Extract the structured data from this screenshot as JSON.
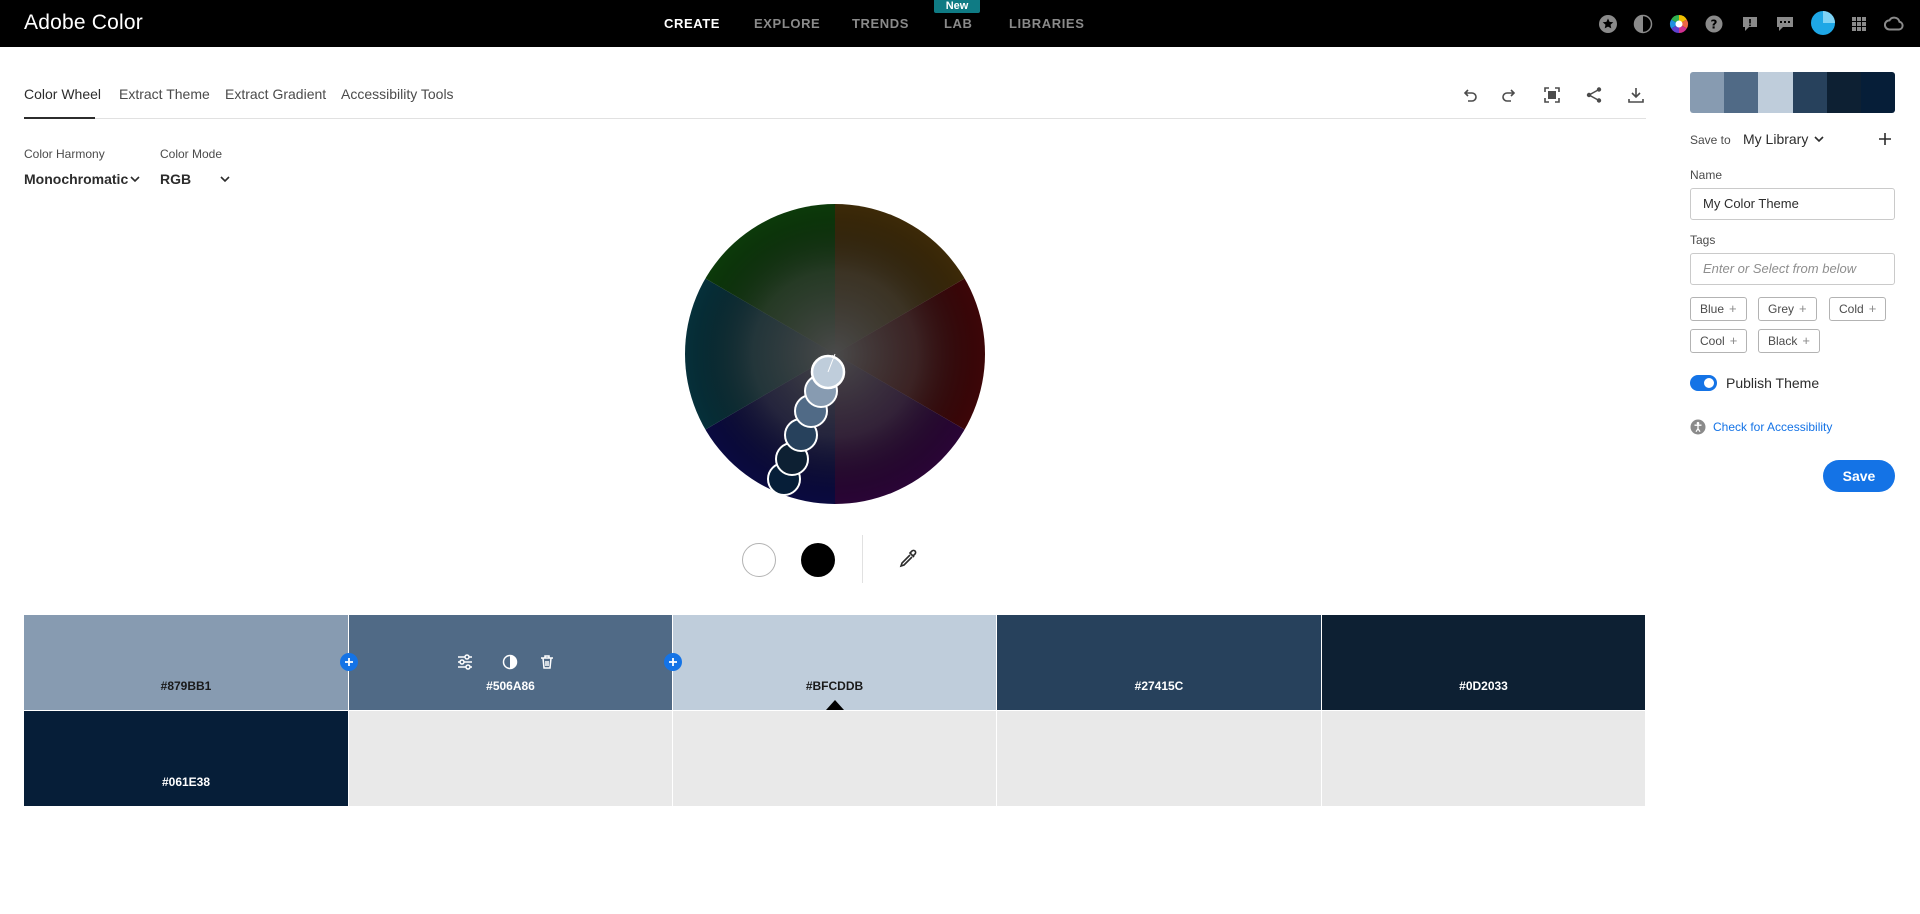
{
  "app": {
    "title": "Adobe Color"
  },
  "nav": {
    "items": [
      {
        "label": "CREATE",
        "active": true
      },
      {
        "label": "EXPLORE",
        "active": false
      },
      {
        "label": "TRENDS",
        "active": false
      },
      {
        "label": "LAB",
        "active": false,
        "badge": "New"
      },
      {
        "label": "LIBRARIES",
        "active": false
      }
    ],
    "icons": [
      "star-icon",
      "contrast-icon",
      "color-wheel-icon",
      "help-icon",
      "feedback-icon",
      "chat-icon",
      "avatar",
      "apps-grid-icon",
      "creative-cloud-icon"
    ]
  },
  "tabs": [
    {
      "label": "Color Wheel",
      "active": true
    },
    {
      "label": "Extract Theme",
      "active": false
    },
    {
      "label": "Extract Gradient",
      "active": false
    },
    {
      "label": "Accessibility Tools",
      "active": false
    }
  ],
  "toolbar": [
    "undo-icon",
    "redo-icon",
    "fullscreen-icon",
    "share-icon",
    "download-icon"
  ],
  "controls": {
    "harmony_label": "Color Harmony",
    "harmony_value": "Monochromatic",
    "mode_label": "Color Mode",
    "mode_value": "RGB"
  },
  "swatches": [
    {
      "hex": "#879BB1",
      "color": "#879bb1",
      "text_color": "#1a1a1a"
    },
    {
      "hex": "#506A86",
      "color": "#506a86",
      "text_color": "#ffffff",
      "selected": true
    },
    {
      "hex": "#BFCDDB",
      "color": "#bfcddb",
      "text_color": "#1a1a1a",
      "base": true
    },
    {
      "hex": "#27415C",
      "color": "#27415c",
      "text_color": "#ffffff"
    },
    {
      "hex": "#0D2033",
      "color": "#0d2033",
      "text_color": "#ffffff"
    },
    {
      "hex": "#061E38",
      "color": "#061e38",
      "text_color": "#ffffff"
    }
  ],
  "panel": {
    "save_to_label": "Save to",
    "library": "My Library",
    "name_label": "Name",
    "name_value": "My Color Theme",
    "tags_label": "Tags",
    "tags_placeholder": "Enter or Select from below",
    "tags": [
      "Blue",
      "Grey",
      "Cold",
      "Cool",
      "Black"
    ],
    "publish_label": "Publish Theme",
    "publish_on": true,
    "accessibility_link": "Check for Accessibility",
    "save_button": "Save"
  },
  "colors": {
    "accent": "#1473e6",
    "topbar": "#000000",
    "lab_badge": "#0f7b84"
  }
}
